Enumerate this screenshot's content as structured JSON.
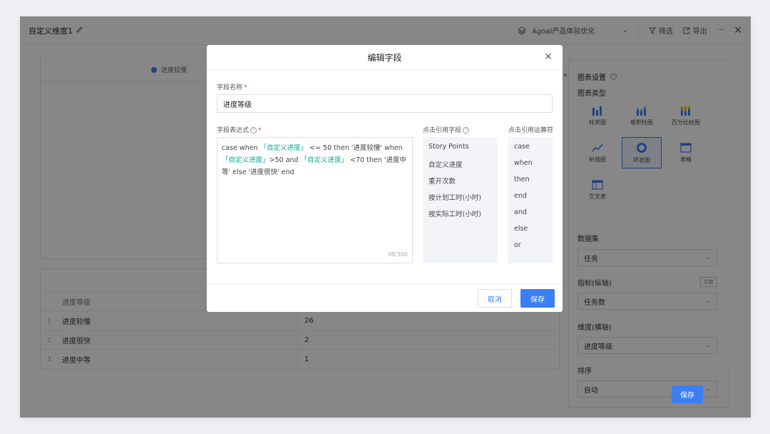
{
  "topbar": {
    "title": "自定义维度1",
    "project": "Agoal产品体验优化",
    "filter_label": "筛选",
    "export_label": "导出",
    "more_label": "···"
  },
  "canvas": {
    "legend_label": "进度较慢"
  },
  "table": {
    "header": "进度等级",
    "rows": [
      {
        "idx": "1",
        "name": "进度较慢",
        "value": "26"
      },
      {
        "idx": "2",
        "name": "进度很快",
        "value": "2"
      },
      {
        "idx": "3",
        "name": "进度中等",
        "value": "1"
      }
    ]
  },
  "settings": {
    "title": "图表设置",
    "chart_type_label": "图表类型",
    "chart_types": [
      "柱状图",
      "堆积柱图",
      "百分比柱图",
      "折线图",
      "环状图",
      "表格",
      "交叉表"
    ],
    "dataset_label": "数据集",
    "dataset_value": "任务",
    "metric_label": "指标(纵轴)",
    "metric_tag": "计数",
    "metric_value": "任务数",
    "dimension_label": "维度(横轴)",
    "dimension_value": "进度等级",
    "sort_label": "排序",
    "sort_value": "自动",
    "save_label": "保存"
  },
  "modal": {
    "title": "编辑字段",
    "name_label": "字段名称",
    "name_value": "进度等级",
    "expr_label": "字段表达式",
    "expr_parts": {
      "p1": "case when ",
      "f1": "「自定义进度」",
      "p2": " <= 50 then '进度较慢' when ",
      "f2": "「自定义进度」",
      "p3": ">50 and ",
      "f3": "「自定义进度」",
      "p4": " <70 then '进度中等' else '进度很快' end"
    },
    "counter": "98/300",
    "fields_label": "点击引用字段",
    "fields": [
      "Story Points",
      "自定义进度",
      "重开次数",
      "按计划工时(小时)",
      "按实际工时(小时)"
    ],
    "ops_label": "点击引用运算符",
    "ops": [
      "case",
      "when",
      "then",
      "end",
      "and",
      "else",
      "or"
    ],
    "cancel_label": "取消",
    "save_label": "保存"
  }
}
